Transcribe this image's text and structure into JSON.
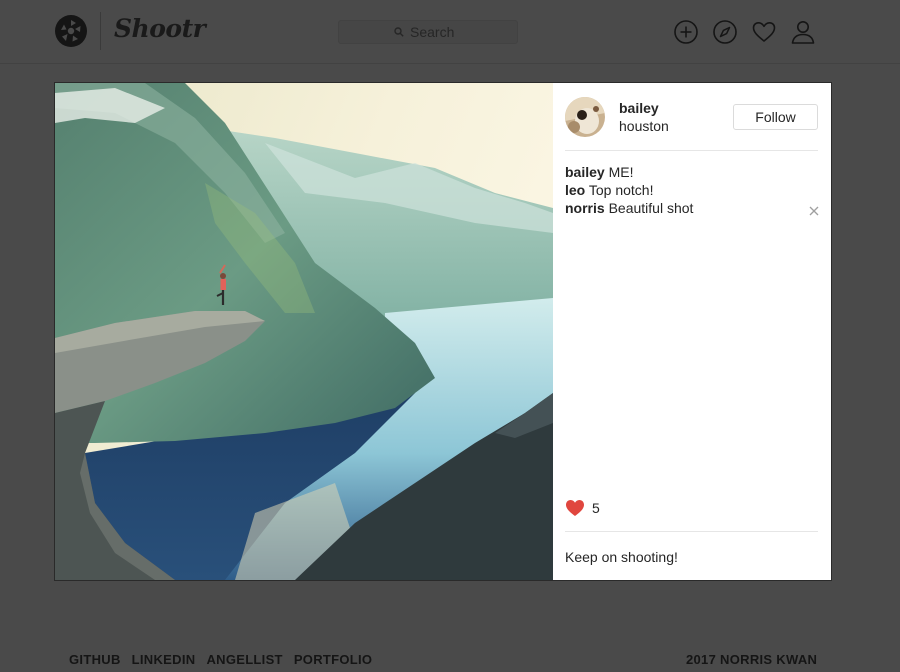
{
  "app": {
    "name": "Shootr"
  },
  "search": {
    "placeholder": "Search"
  },
  "nav": {
    "icons": [
      "add-icon",
      "compass-icon",
      "heart-icon",
      "user-icon"
    ]
  },
  "post": {
    "user": {
      "name": "bailey",
      "location": "houston"
    },
    "follow_label": "Follow",
    "comments": [
      {
        "user": "bailey",
        "text": "ME!"
      },
      {
        "user": "leo",
        "text": "Top notch!"
      },
      {
        "user": "norris",
        "text": "Beautiful shot"
      }
    ],
    "likes": "5",
    "comment_placeholder": "Keep on shooting!"
  },
  "footer": {
    "links": [
      "GITHUB",
      "LINKEDIN",
      "ANGELLIST",
      "PORTFOLIO"
    ],
    "copyright": "2017 NORRIS KWAN"
  },
  "colors": {
    "overlay_bg": "#4a4a4a",
    "like": "#ed4956",
    "text": "#262626"
  }
}
